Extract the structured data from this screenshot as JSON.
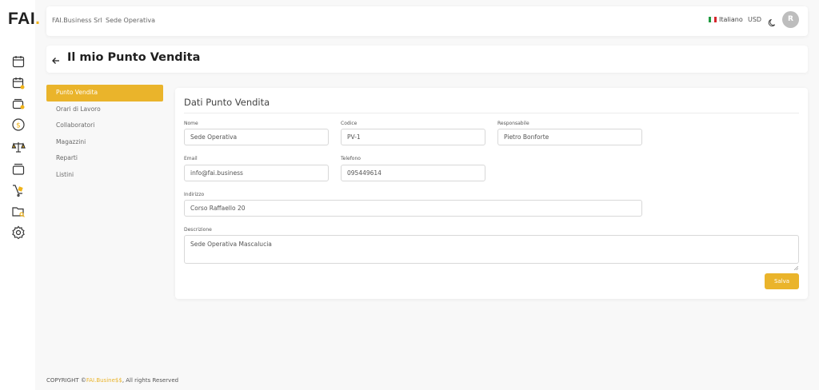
{
  "app": {
    "logo_text": "FAI",
    "logo_dot": ".",
    "accent_color": "#eab42b"
  },
  "rail": {
    "icons": [
      "calendar-icon",
      "calendar-user-icon",
      "wallet-icon",
      "dollar-icon",
      "scale-icon",
      "cards-icon",
      "cart-icon",
      "folder-search-icon",
      "settings-icon"
    ]
  },
  "topbar": {
    "company": "FAI.Business Srl",
    "location": "Sede Operativa",
    "language": "Italiano",
    "currency": "USD",
    "avatar_initial": "R"
  },
  "header": {
    "title": "Il mio Punto Vendita"
  },
  "menu": {
    "items": [
      {
        "label": "Punto Vendita",
        "active": true
      },
      {
        "label": "Orari di Lavoro",
        "active": false
      },
      {
        "label": "Collaboratori",
        "active": false
      },
      {
        "label": "Magazzini",
        "active": false
      },
      {
        "label": "Reparti",
        "active": false
      },
      {
        "label": "Listini",
        "active": false
      }
    ]
  },
  "form": {
    "title": "Dati Punto Vendita",
    "nome": {
      "label": "Nome",
      "value": "Sede Operativa"
    },
    "codice": {
      "label": "Codice",
      "value": "PV-1"
    },
    "responsabile": {
      "label": "Responsabile",
      "value": "Pietro Bonforte"
    },
    "email": {
      "label": "Email",
      "value": "info@fai.business"
    },
    "telefono": {
      "label": "Telefono",
      "value": "095449614"
    },
    "indirizzo": {
      "label": "Indirizzo",
      "value": "Corso Raffaello 20"
    },
    "descrizione": {
      "label": "Descrizione",
      "value": "Sede Operativa Mascalucia"
    },
    "save_label": "Salva"
  },
  "footer": {
    "prefix": "COPYRIGHT ©",
    "brand": "FAI.Busine$$",
    "suffix": ", All rights Reserved"
  }
}
